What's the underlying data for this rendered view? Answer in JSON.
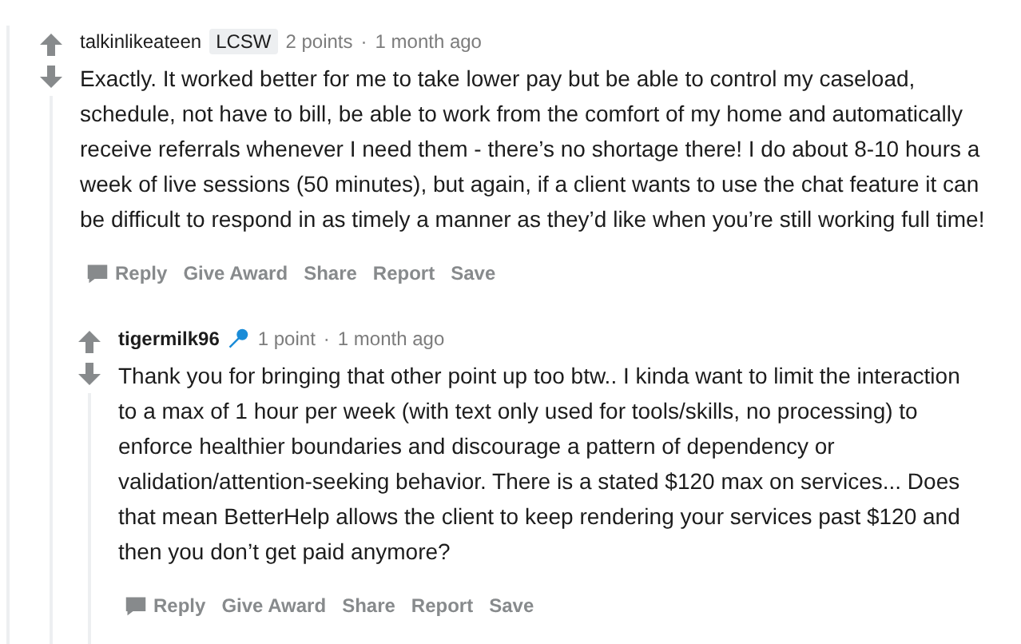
{
  "comments": [
    {
      "author": "talkinlikeateen",
      "flair": "LCSW",
      "points": "2 points",
      "separator": "·",
      "time": "1 month ago",
      "body": "Exactly. It worked better for me to take lower pay but be able to control my caseload, schedule, not have to bill, be able to work from the comfort of my home and automatically receive referrals whenever I need them - there’s no shortage there! I do about 8-10 hours a week of live sessions (50 minutes), but again, if a client wants to use the chat feature it can be difficult to respond in as timely a manner as they’d like when you’re still working full time!",
      "actions": [
        "Reply",
        "Give Award",
        "Share",
        "Report",
        "Save"
      ],
      "children": [
        {
          "author": "tigermilk96",
          "mic_flair": true,
          "points": "1 point",
          "separator": "·",
          "time": "1 month ago",
          "body": "Thank you for bringing that other point up too btw.. I kinda want to limit the interaction to a max of 1 hour per week (with text only used for tools/skills, no processing) to enforce healthier boundaries and discourage a pattern of dependency or validation/attention-seeking behavior. There is a stated $120 max on services... Does that mean BetterHelp allows the client to keep rendering your services past $120 and then you don’t get paid anymore?",
          "actions": [
            "Reply",
            "Give Award",
            "Share",
            "Report",
            "Save"
          ]
        }
      ]
    }
  ]
}
